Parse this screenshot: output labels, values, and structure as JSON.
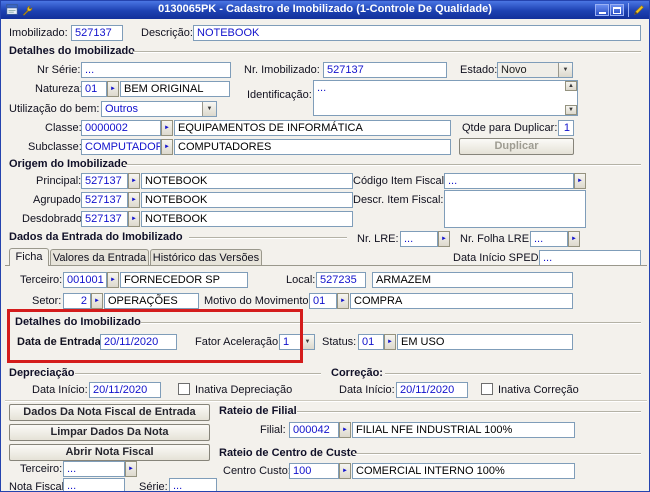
{
  "icons": {
    "lookup": "►",
    "dropdown": "▼",
    "scroll_up": "▲",
    "scroll_down": "▼"
  },
  "colors": {
    "titlebar": "#1d41b2",
    "field_text": "#1111cc",
    "annotation": "#d41c1c"
  },
  "titlebar": {
    "title": "0130065PK - Cadastro de Imobilizado (1-Controle De Qualidade)"
  },
  "top": {
    "imobilizado": {
      "label": "Imobilizado:",
      "value": "527137"
    },
    "descricao": {
      "label": "Descrição:",
      "value": "NOTEBOOK"
    }
  },
  "detalhes": {
    "title": "Detalhes do Imobilizado",
    "nr_serie": {
      "label": "Nr Série:",
      "value": "..."
    },
    "nr_imobilizado": {
      "label": "Nr. Imobilizado:",
      "value": "527137"
    },
    "estado": {
      "label": "Estado:",
      "value": "Novo"
    },
    "natureza": {
      "label": "Natureza:",
      "code": "01",
      "desc": "BEM ORIGINAL"
    },
    "identificacao": {
      "label": "Identificação:",
      "value": "..."
    },
    "utilizacao": {
      "label": "Utilização do bem:",
      "value": "Outros"
    },
    "classe": {
      "label": "Classe:",
      "code": "0000002",
      "desc": "EQUIPAMENTOS DE INFORMÁTICA"
    },
    "qtde_duplicar": {
      "label": "Qtde para Duplicar:",
      "value": "1"
    },
    "subclasse": {
      "label": "Subclasse:",
      "code": "COMPUTADORES",
      "desc": "COMPUTADORES"
    },
    "duplicar_button": "Duplicar"
  },
  "origem": {
    "title": "Origem do Imobilizado",
    "principal": {
      "label": "Principal:",
      "code": "527137",
      "desc": "NOTEBOOK"
    },
    "agrupado": {
      "label": "Agrupado:",
      "code": "527137",
      "desc": "NOTEBOOK"
    },
    "desdobrado": {
      "label": "Desdobrado:",
      "code": "527137",
      "desc": "NOTEBOOK"
    },
    "codigo_item_fiscal": {
      "label": "Código Item Fiscal:",
      "value": "..."
    },
    "descr_item_fiscal": {
      "label": "Descr. Item Fiscal:",
      "value": ""
    }
  },
  "entrada": {
    "title": "Dados da Entrada do Imobilizado",
    "nr_lre": {
      "label": "Nr. LRE:",
      "value": "..."
    },
    "nr_folha_lre": {
      "label": "Nr. Folha LRE:",
      "value": "..."
    }
  },
  "tabs": {
    "items": [
      {
        "label": "Ficha"
      },
      {
        "label": "Valores da Entrada"
      },
      {
        "label": "Histórico das Versões"
      }
    ],
    "data_inicio_sped": {
      "label": "Data Início SPED:",
      "value": "..."
    }
  },
  "ficha": {
    "terceiro": {
      "label": "Terceiro:",
      "code": "001001",
      "desc": "FORNECEDOR SP"
    },
    "local": {
      "label": "Local:",
      "code": "527235",
      "desc": "ARMAZEM"
    },
    "setor": {
      "label": "Setor:",
      "code": "2",
      "desc": "OPERAÇÕES"
    },
    "motivo": {
      "label": "Motivo do Movimento:",
      "code": "01",
      "desc": "COMPRA"
    },
    "detalhes": {
      "title": "Detalhes do Imobilizado",
      "data_entrada": {
        "label": "Data de Entrada:",
        "value": "20/11/2020"
      },
      "fator_aceleracao": {
        "label": "Fator Aceleração:",
        "value": "1"
      },
      "status": {
        "label": "Status:",
        "code": "01",
        "desc": "EM USO"
      }
    },
    "depreciacao": {
      "title": "Depreciação",
      "data_inicio": {
        "label": "Data Início:",
        "value": "20/11/2020"
      },
      "inativa": "Inativa Depreciação"
    },
    "correcao": {
      "title": "Correção:",
      "data_inicio": {
        "label": "Data Início:",
        "value": "20/11/2020"
      },
      "inativa": "Inativa Correção"
    },
    "nota": {
      "buttons": [
        "Dados Da Nota Fiscal de Entrada",
        "Limpar Dados Da Nota",
        "Abrir Nota Fiscal"
      ],
      "terceiro": {
        "label": "Terceiro:",
        "value": "..."
      },
      "nota_fiscal": {
        "label": "Nota Fiscal:",
        "value": "..."
      },
      "serie": {
        "label": "Série:",
        "value": "..."
      }
    },
    "rateio_filial": {
      "title": "Rateio de Filial",
      "filial": {
        "label": "Filial:",
        "code": "000042",
        "desc": "FILIAL NFE INDUSTRIAL 100%"
      }
    },
    "rateio_cc": {
      "title": "Rateio de Centro de Custo",
      "centro_custo": {
        "label": "Centro Custo:",
        "code": "100",
        "desc": "COMERCIAL INTERNO 100%"
      }
    }
  }
}
